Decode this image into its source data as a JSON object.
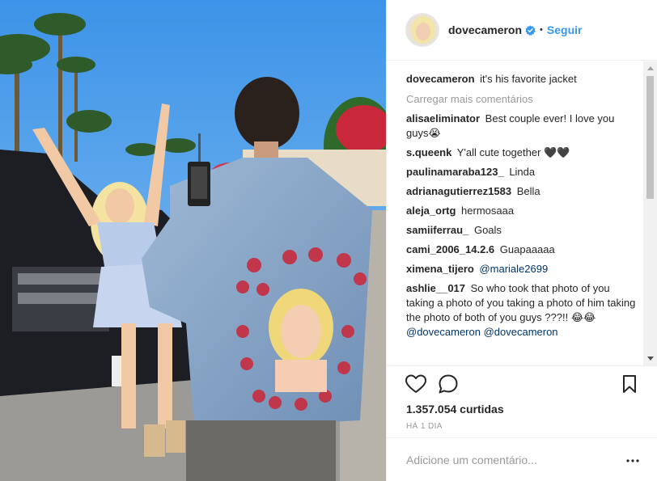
{
  "post": {
    "username": "dovecameron",
    "verified": true,
    "separator": "•",
    "follow_label": "Seguir",
    "likes_text": "1.357.054 curtidas",
    "time_ago": "HÁ 1 DIA"
  },
  "caption": {
    "username": "dovecameron",
    "text": "it's his favorite jacket"
  },
  "load_more_label": "Carregar mais comentários",
  "comments": [
    {
      "username": "alisaeliminator",
      "text": "Best couple ever! I love you guys😭"
    },
    {
      "username": "s.queenk",
      "text": "Y'all cute together 🖤🖤"
    },
    {
      "username": "paulinamaraba123_",
      "text": "Linda"
    },
    {
      "username": "adrianagutierrez1583",
      "text": "Bella"
    },
    {
      "username": "aleja_ortg",
      "text": "hermosaaa"
    },
    {
      "username": "samiiferrau_",
      "text": "Goals"
    },
    {
      "username": "cami_2006_14.2.6",
      "text": "Guapaaaaa"
    },
    {
      "username": "ximena_tijero",
      "mention": "@mariale2699"
    },
    {
      "username": "ashlie__017",
      "text": "So who took that photo of you taking a photo of you taking a photo of him taking the photo of both of you guys ???!! 😂😂",
      "mention": "@dovecameron @dovecameron"
    }
  ],
  "add_comment_placeholder": "Adicione um comentário...",
  "icons": {
    "like": "heart-icon",
    "comment": "comment-bubble-icon",
    "save": "bookmark-icon",
    "more": "more-options-icon",
    "verified": "verified-badge-icon"
  },
  "colors": {
    "link_blue": "#3897f0",
    "text": "#262626",
    "muted": "#999999",
    "verified": "#3897f0"
  }
}
